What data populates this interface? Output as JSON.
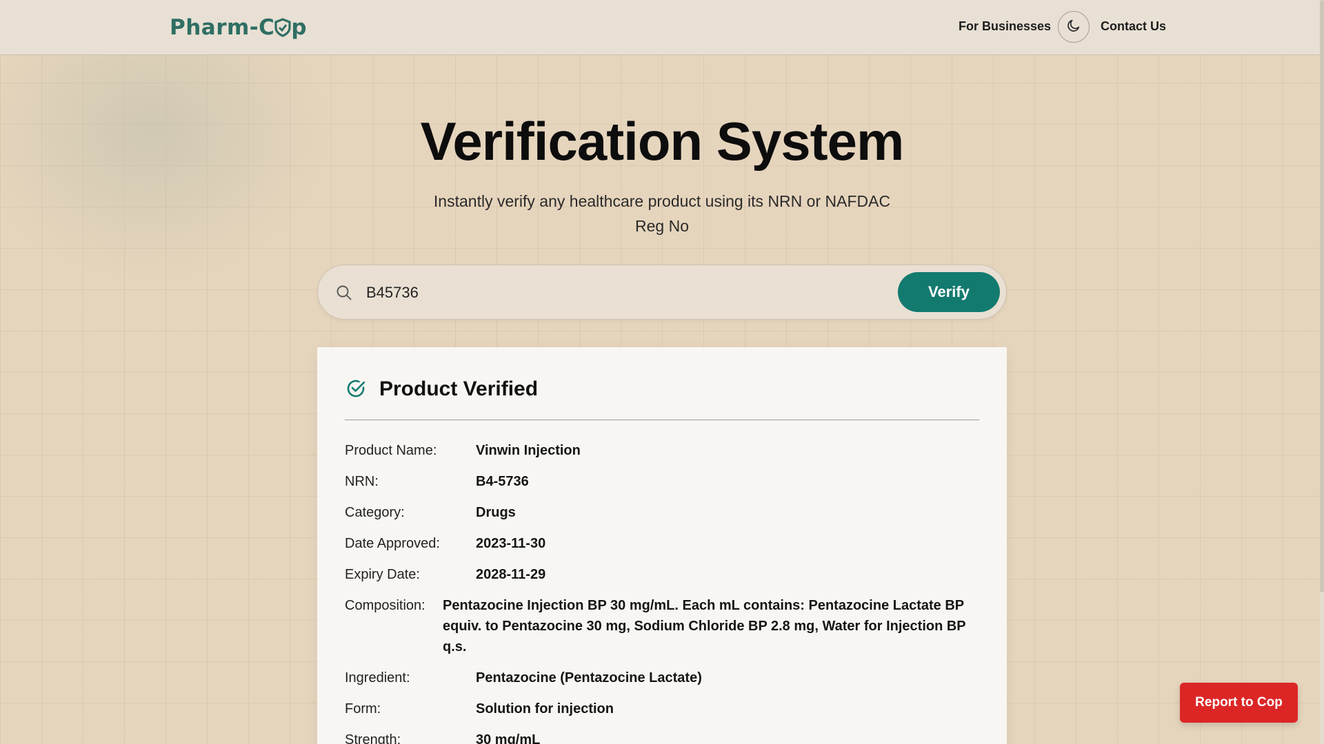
{
  "nav": {
    "logo_prefix": "Pharm-C",
    "logo_suffix": "p",
    "for_businesses": "For Businesses",
    "contact_us": "Contact Us",
    "theme_toggle_icon": "moon-icon"
  },
  "hero": {
    "title": "Verification System",
    "subtitle": "Instantly verify any healthcare product using its NRN or NAFDAC Reg No"
  },
  "search": {
    "value": "B45736",
    "verify_label": "Verify",
    "icon": "search-icon"
  },
  "result": {
    "status_icon": "check-circle-icon",
    "title": "Product Verified",
    "fields": [
      {
        "label": "Product Name:",
        "value": "Vinwin Injection"
      },
      {
        "label": "NRN:",
        "value": "B4-5736"
      },
      {
        "label": "Category:",
        "value": "Drugs"
      },
      {
        "label": "Date Approved:",
        "value": "2023-11-30"
      },
      {
        "label": "Expiry Date:",
        "value": "2028-11-29"
      },
      {
        "label": "Composition:",
        "value": "Pentazocine Injection BP 30 mg/mL. Each mL contains: Pentazocine Lactate BP equiv. to Pentazocine 30 mg, Sodium Chloride BP 2.8 mg, Water for Injection BP q.s."
      },
      {
        "label": "Ingredient:",
        "value": "Pentazocine (Pentazocine Lactate)"
      },
      {
        "label": "Form:",
        "value": "Solution for injection"
      },
      {
        "label": "Strength:",
        "value": "30 mg/mL"
      }
    ]
  },
  "report_button": "Report to Cop",
  "colors": {
    "accent": "#137a70",
    "report": "#dc2626",
    "logo": "#2f6e63"
  }
}
